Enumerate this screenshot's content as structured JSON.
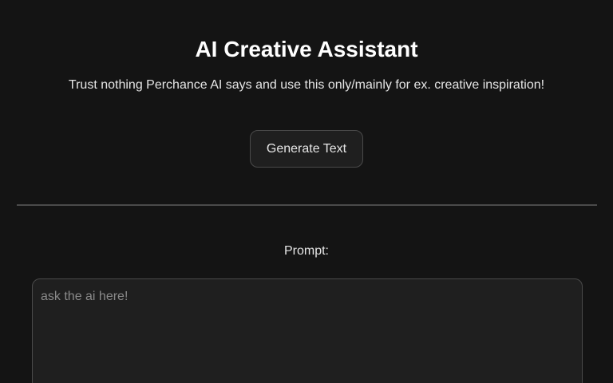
{
  "header": {
    "title": "AI Creative Assistant",
    "subtitle": "Trust nothing Perchance AI says and use this only/mainly for ex. creative inspiration!"
  },
  "actions": {
    "generate_label": "Generate Text"
  },
  "prompt": {
    "label": "Prompt:",
    "placeholder": "ask the ai here!",
    "value": ""
  },
  "colors": {
    "background": "#141414",
    "panel": "#1f1f1f",
    "border": "#4a4a4a",
    "text": "#e6e6e6",
    "title": "#ffffff",
    "placeholder": "#8a8a8a"
  }
}
